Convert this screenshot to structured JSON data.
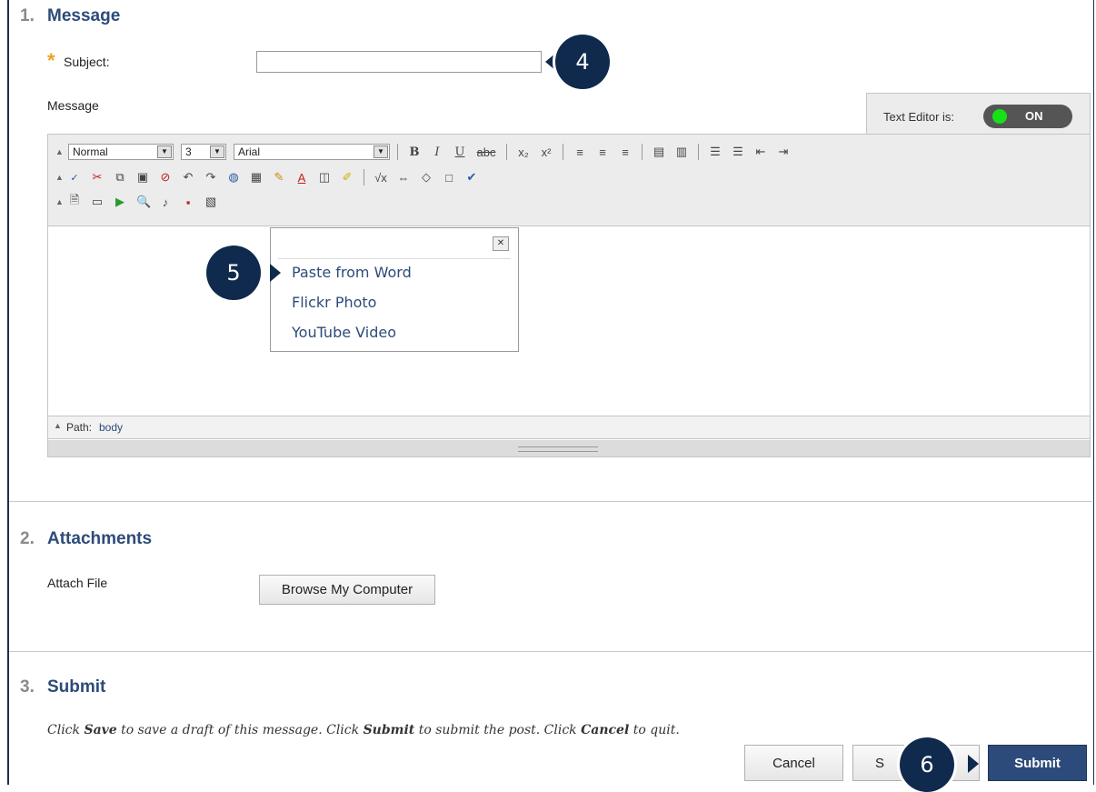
{
  "sections": {
    "message": {
      "num": "1.",
      "title": "Message"
    },
    "attachments": {
      "num": "2.",
      "title": "Attachments"
    },
    "submit": {
      "num": "3.",
      "title": "Submit"
    }
  },
  "subject": {
    "label": "Subject:",
    "required_mark": "*",
    "value": ""
  },
  "message_label": "Message",
  "text_editor": {
    "label": "Text Editor is:",
    "state": "ON"
  },
  "toolbar": {
    "format_select": "Normal",
    "size_select": "3",
    "font_select": "Arial",
    "collapse_glyph": "▲"
  },
  "popup_menu": {
    "items": [
      "Paste from Word",
      "Flickr Photo",
      "YouTube Video"
    ],
    "close_glyph": "✕"
  },
  "pathbar": {
    "label": "Path:",
    "value": "body"
  },
  "attach": {
    "label": "Attach File",
    "button": "Browse My Computer"
  },
  "instructions": {
    "t1": "Click ",
    "save_word": "Save",
    "t2": " to save a draft of this message. Click ",
    "submit_word": "Submit",
    "t3": " to submit the post. Click ",
    "cancel_word": "Cancel",
    "t4": " to quit."
  },
  "buttons": {
    "cancel": "Cancel",
    "save_visible": "S",
    "submit": "Submit"
  },
  "callouts": {
    "c4": "4",
    "c5": "5",
    "c6": "6"
  },
  "colors": {
    "accent": "#2d4b7a",
    "callout": "#0f2a4d",
    "required": "#f0a020",
    "toggle_on": "#18e018"
  }
}
